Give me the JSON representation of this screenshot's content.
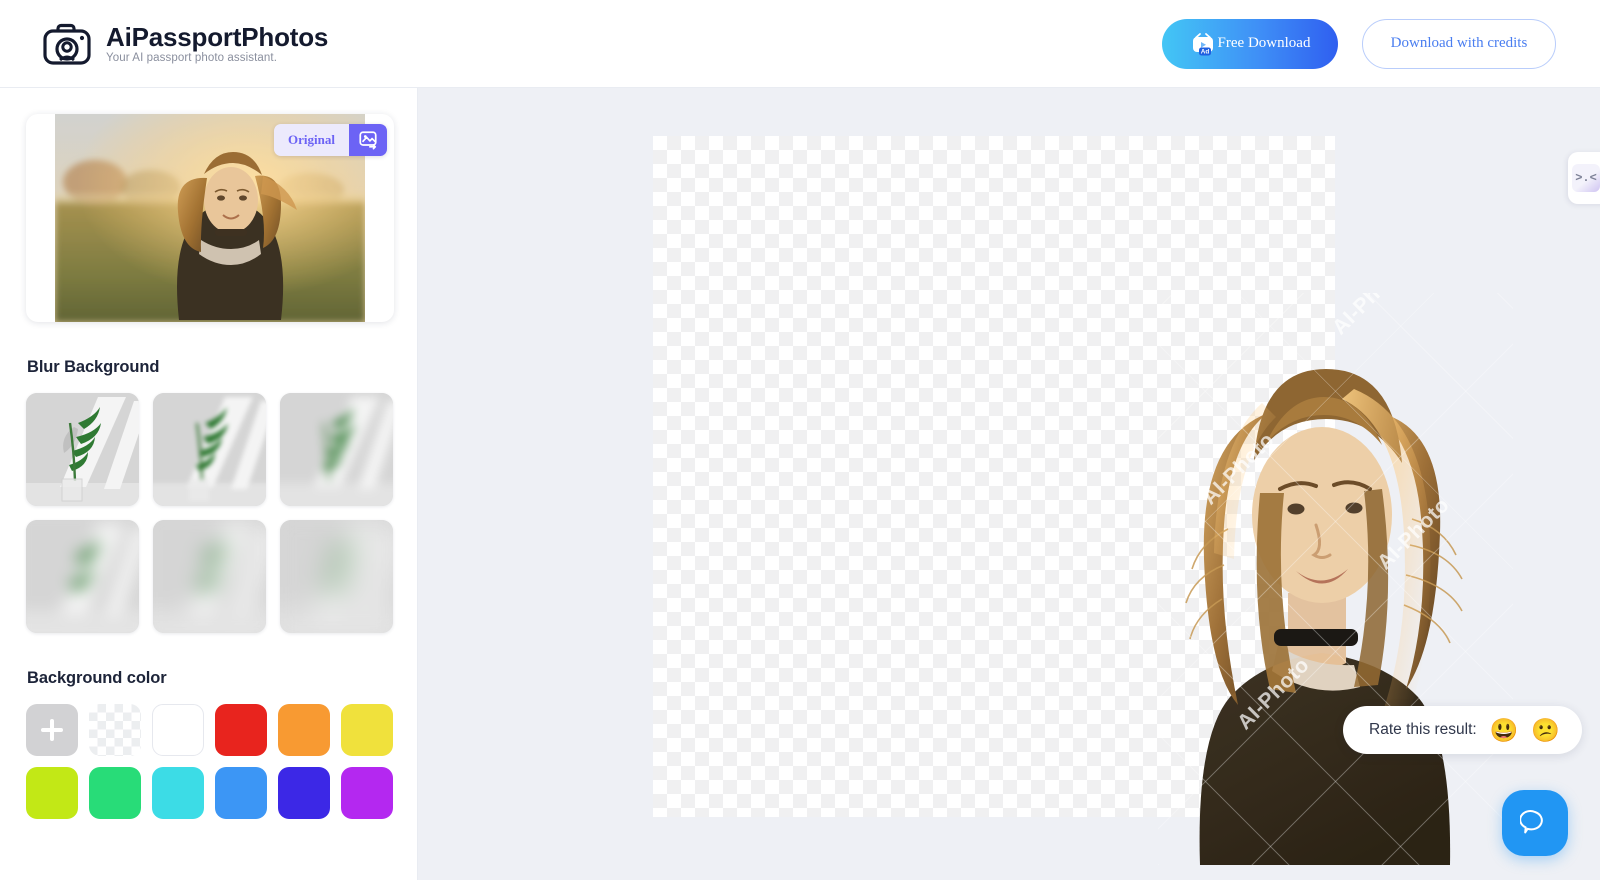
{
  "brand": {
    "title": "AiPassportPhotos",
    "tagline": "Your AI passport photo assistant.",
    "logo_icon": "camera-icon"
  },
  "header": {
    "free_download_label": "Free Download",
    "free_download_icon": "ad-tv-icon",
    "credits_label": "Download with credits",
    "gradient_start": "#43c6f5",
    "gradient_end": "#2f5ff0",
    "credits_text_color": "#4a7ef0"
  },
  "preview": {
    "original_label": "Original",
    "swap_icon": "image-swap-icon",
    "photo_alt": "woman in field at sunset wearing black t-shirt and choker",
    "accent": "#6c63f5"
  },
  "blur_section": {
    "title": "Blur Background",
    "items": [
      {
        "name": "blur-level-1",
        "blur": "0"
      },
      {
        "name": "blur-level-2",
        "blur": "2.5"
      },
      {
        "name": "blur-level-3",
        "blur": "5"
      },
      {
        "name": "blur-level-4",
        "blur": "8"
      },
      {
        "name": "blur-level-5",
        "blur": "11"
      },
      {
        "name": "blur-level-6",
        "blur": "14"
      }
    ]
  },
  "color_section": {
    "title": "Background color",
    "swatches": [
      {
        "name": "add-custom-color",
        "kind": "add",
        "color": "#d2d2d4"
      },
      {
        "name": "transparent-color",
        "kind": "transparent",
        "color": "transparent"
      },
      {
        "name": "white-color",
        "kind": "solid",
        "color": "#ffffff"
      },
      {
        "name": "red-color",
        "kind": "solid",
        "color": "#e8241e"
      },
      {
        "name": "orange-color",
        "kind": "solid",
        "color": "#f89a32"
      },
      {
        "name": "yellow-color",
        "kind": "solid",
        "color": "#f0e13c"
      },
      {
        "name": "lime-color",
        "kind": "solid",
        "color": "#c2e816"
      },
      {
        "name": "green-color",
        "kind": "solid",
        "color": "#28dc78"
      },
      {
        "name": "cyan-color",
        "kind": "solid",
        "color": "#3cdce6"
      },
      {
        "name": "blue-color",
        "kind": "solid",
        "color": "#3c96f5"
      },
      {
        "name": "indigo-color",
        "kind": "solid",
        "color": "#3c28e6"
      },
      {
        "name": "magenta-color",
        "kind": "solid",
        "color": "#b428f0"
      }
    ]
  },
  "canvas": {
    "background": "#eef0f5",
    "watermark_text": "AI-Photo",
    "transparency": "checkerboard"
  },
  "side_tab": {
    "icon_label": ">.<"
  },
  "rate": {
    "label": "Rate this result:",
    "happy_emoji": "😃",
    "sad_emoji": "😕"
  },
  "chat": {
    "icon": "chat-bubble-icon",
    "color": "#2196f3"
  }
}
